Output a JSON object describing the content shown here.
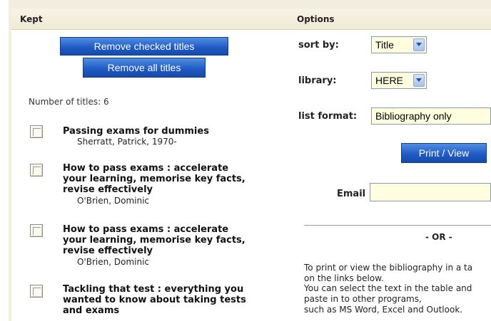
{
  "kept": {
    "header": "Kept",
    "remove_checked_label": "Remove checked titles",
    "remove_all_label": "Remove all titles",
    "count_text": "Number of titles: 6",
    "items": [
      {
        "title_lines": [
          "Passing exams for dummies"
        ],
        "author": "Sherratt, Patrick, 1970-"
      },
      {
        "title_lines": [
          "How to pass exams : accelerate",
          "your learning, memorise key facts,",
          "revise effectively"
        ],
        "author": "O'Brien, Dominic"
      },
      {
        "title_lines": [
          "How to pass exams : accelerate",
          "your learning, memorise key facts,",
          "revise effectively"
        ],
        "author": "O'Brien, Dominic"
      },
      {
        "title_lines": [
          "Tackling that test : everything you",
          "wanted to know about taking tests",
          "and exams"
        ],
        "author": ""
      }
    ]
  },
  "options": {
    "header": "Options",
    "sort_label": "sort by:",
    "sort_value": "Title",
    "library_label": "library:",
    "library_value": "HERE",
    "format_label": "list format:",
    "format_value": "Bibliography only",
    "print_label": "Print / View",
    "email_label": "Email",
    "or_text": "- OR -",
    "para_lines": [
      "To print or view the bibliography in a ta",
      "on the links below.",
      "You can select the text in the table and",
      "paste in to other programs,",
      "such as MS Word, Excel and Outlook."
    ]
  },
  "colors": {
    "header_bg": "#efead6",
    "button_blue": "#1e58c4",
    "input_bg": "#ffffe0"
  }
}
